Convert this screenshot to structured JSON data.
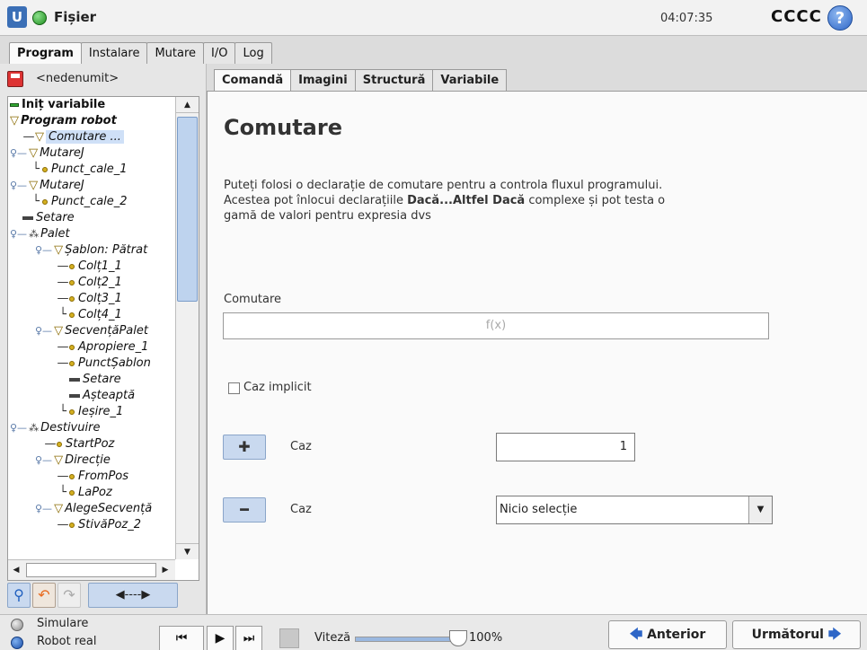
{
  "titlebar": {
    "file_menu": "Fișier",
    "clock": "04:07:35",
    "robot_name": "CCCC",
    "help_icon": "?"
  },
  "main_tabs": [
    "Program",
    "Instalare",
    "Mutare",
    "I/O",
    "Log"
  ],
  "left": {
    "program_name": "<nedenumit>",
    "tree": [
      {
        "label": "Iniț variabile",
        "icon": "init-icon"
      },
      {
        "label": "Program robot",
        "icon": "program-triangle-icon"
      },
      {
        "label": "Comutare ...",
        "icon": "switch-triangle-icon"
      },
      {
        "label": "MutareJ",
        "icon": "movej-triangle-icon"
      },
      {
        "label": "Punct_cale_1",
        "icon": "waypoint-dot-icon"
      },
      {
        "label": "MutareJ",
        "icon": "movej-triangle-icon"
      },
      {
        "label": "Punct_cale_2",
        "icon": "waypoint-dot-icon"
      },
      {
        "label": "Setare",
        "icon": "set-bar-icon"
      },
      {
        "label": "Palet",
        "icon": "pallet-icon"
      },
      {
        "label": "Șablon: Pătrat",
        "icon": "pattern-triangle-icon"
      },
      {
        "label": "Colț1_1",
        "icon": "waypoint-dot-icon"
      },
      {
        "label": "Colț2_1",
        "icon": "waypoint-dot-icon"
      },
      {
        "label": "Colț3_1",
        "icon": "waypoint-dot-icon"
      },
      {
        "label": "Colț4_1",
        "icon": "waypoint-dot-icon"
      },
      {
        "label": "SecvențăPalet",
        "icon": "sequence-triangle-icon"
      },
      {
        "label": "Apropiere_1",
        "icon": "waypoint-dot-icon"
      },
      {
        "label": "PunctȘablon",
        "icon": "waypoint-dot-icon"
      },
      {
        "label": "Setare",
        "icon": "set-bar-icon"
      },
      {
        "label": "Așteaptă",
        "icon": "wait-bar-icon"
      },
      {
        "label": "Ieșire_1",
        "icon": "waypoint-dot-icon"
      },
      {
        "label": "Destivuire",
        "icon": "pallet-icon"
      },
      {
        "label": "StartPoz",
        "icon": "waypoint-dot-icon"
      },
      {
        "label": "Direcție",
        "icon": "direction-triangle-icon"
      },
      {
        "label": "FromPos",
        "icon": "waypoint-dot-icon"
      },
      {
        "label": "LaPoz",
        "icon": "waypoint-dot-icon"
      },
      {
        "label": "AlegeSecvență",
        "icon": "sequence-triangle-icon"
      },
      {
        "label": "StivăPoz_2",
        "icon": "waypoint-dot-icon"
      }
    ],
    "move_button": "◀----▶"
  },
  "sub_tabs": [
    "Comandă",
    "Imagini",
    "Structură",
    "Variabile"
  ],
  "command": {
    "title": "Comutare",
    "desc_1": "Puteți folosi o declarație de comutare pentru a controla fluxul programului.",
    "desc_2a": "Acestea pot înlocui declarațiile ",
    "desc_2b": "Dacă...Altfel Dacă",
    "desc_2c": " complexe și pot testa o",
    "desc_3": "gamă de valori pentru expresia dvs",
    "switch_label": "Comutare",
    "expr_placeholder": "f(x)",
    "default_case_label": "Caz implicit",
    "default_case_checked": false,
    "add_case_label": "Caz",
    "add_case_value": "1",
    "remove_case_label": "Caz",
    "remove_case_selected": "Nicio selecție"
  },
  "footer": {
    "simulation": "Simulare",
    "real_robot": "Robot real",
    "speed_label": "Viteză",
    "speed_value": "100%",
    "speed_fraction": 1.0,
    "prev": "Anterior",
    "next": "Următorul"
  },
  "colors": {
    "accent": "#2e66c7",
    "button_blue": "#c9d9ef",
    "selected_row": "#cfe0f7"
  }
}
